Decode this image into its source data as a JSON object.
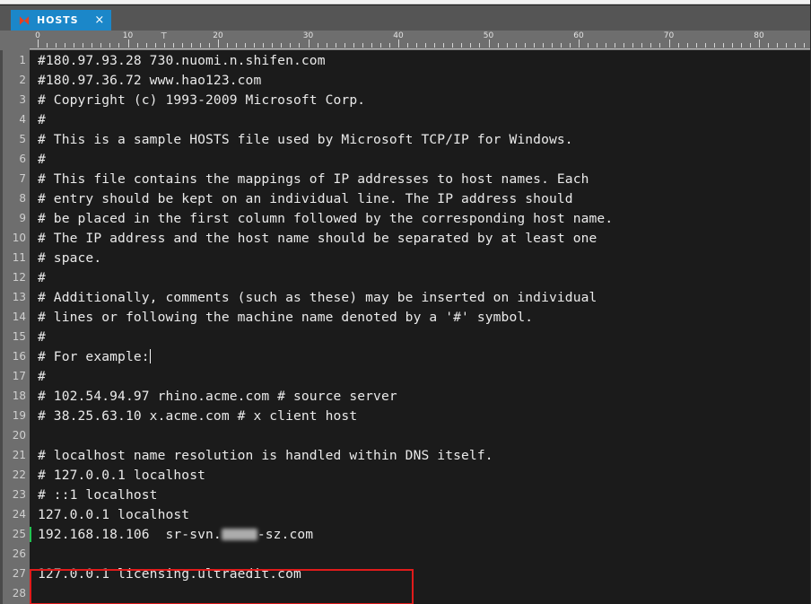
{
  "window": {
    "title_strip_color": "#f2f2f2",
    "tabbar_color": "#555555"
  },
  "tabbar": {
    "tabs": [
      {
        "label": "HOSTS",
        "icon": "red-diamond-icon",
        "close_label": "×",
        "active": true,
        "active_color": "#1b87c9"
      }
    ]
  },
  "ruler": {
    "unit_numbers": [
      "0",
      "10",
      "20",
      "30",
      "40",
      "50",
      "60",
      "70",
      "80"
    ],
    "tab_stop_marker": "T",
    "background_color": "#6e6e6e"
  },
  "editor": {
    "background_color": "#1b1b1b",
    "gutter_color": "#6e6e6e",
    "text_color": "#eaeaea",
    "changed_line_marker_color": "#22c552",
    "caret_line": 16,
    "lines": [
      {
        "n": "1",
        "text": "#180.97.93.28 730.nuomi.n.shifen.com"
      },
      {
        "n": "2",
        "text": "#180.97.36.72 www.hao123.com"
      },
      {
        "n": "3",
        "text": "# Copyright (c) 1993-2009 Microsoft Corp."
      },
      {
        "n": "4",
        "text": "#"
      },
      {
        "n": "5",
        "text": "# This is a sample HOSTS file used by Microsoft TCP/IP for Windows."
      },
      {
        "n": "6",
        "text": "#"
      },
      {
        "n": "7",
        "text": "# This file contains the mappings of IP addresses to host names. Each"
      },
      {
        "n": "8",
        "text": "# entry should be kept on an individual line. The IP address should"
      },
      {
        "n": "9",
        "text": "# be placed in the first column followed by the corresponding host name."
      },
      {
        "n": "10",
        "text": "# The IP address and the host name should be separated by at least one"
      },
      {
        "n": "11",
        "text": "# space."
      },
      {
        "n": "12",
        "text": "#"
      },
      {
        "n": "13",
        "text": "# Additionally, comments (such as these) may be inserted on individual"
      },
      {
        "n": "14",
        "text": "# lines or following the machine name denoted by a '#' symbol."
      },
      {
        "n": "15",
        "text": "#"
      },
      {
        "n": "16",
        "text": "# For example:",
        "caret": true
      },
      {
        "n": "17",
        "text": "#"
      },
      {
        "n": "18",
        "text": "# 102.54.94.97 rhino.acme.com # source server"
      },
      {
        "n": "19",
        "text": "# 38.25.63.10 x.acme.com # x client host"
      },
      {
        "n": "20",
        "text": ""
      },
      {
        "n": "21",
        "text": "# localhost name resolution is handled within DNS itself."
      },
      {
        "n": "22",
        "text": "# 127.0.0.1 localhost"
      },
      {
        "n": "23",
        "text": "# ::1 localhost"
      },
      {
        "n": "24",
        "text": "127.0.0.1 localhost"
      },
      {
        "n": "25",
        "text_before": "192.168.18.106  sr-svn.",
        "text_after": "-sz.com",
        "redacted": true,
        "changed": true
      },
      {
        "n": "26",
        "text": ""
      },
      {
        "n": "27",
        "text": "127.0.0.1 licensing.ultraedit.com"
      },
      {
        "n": "28",
        "text": ""
      }
    ]
  },
  "annotation": {
    "shape": "rectangle",
    "color": "#e01b1b",
    "targets_line": "25"
  }
}
